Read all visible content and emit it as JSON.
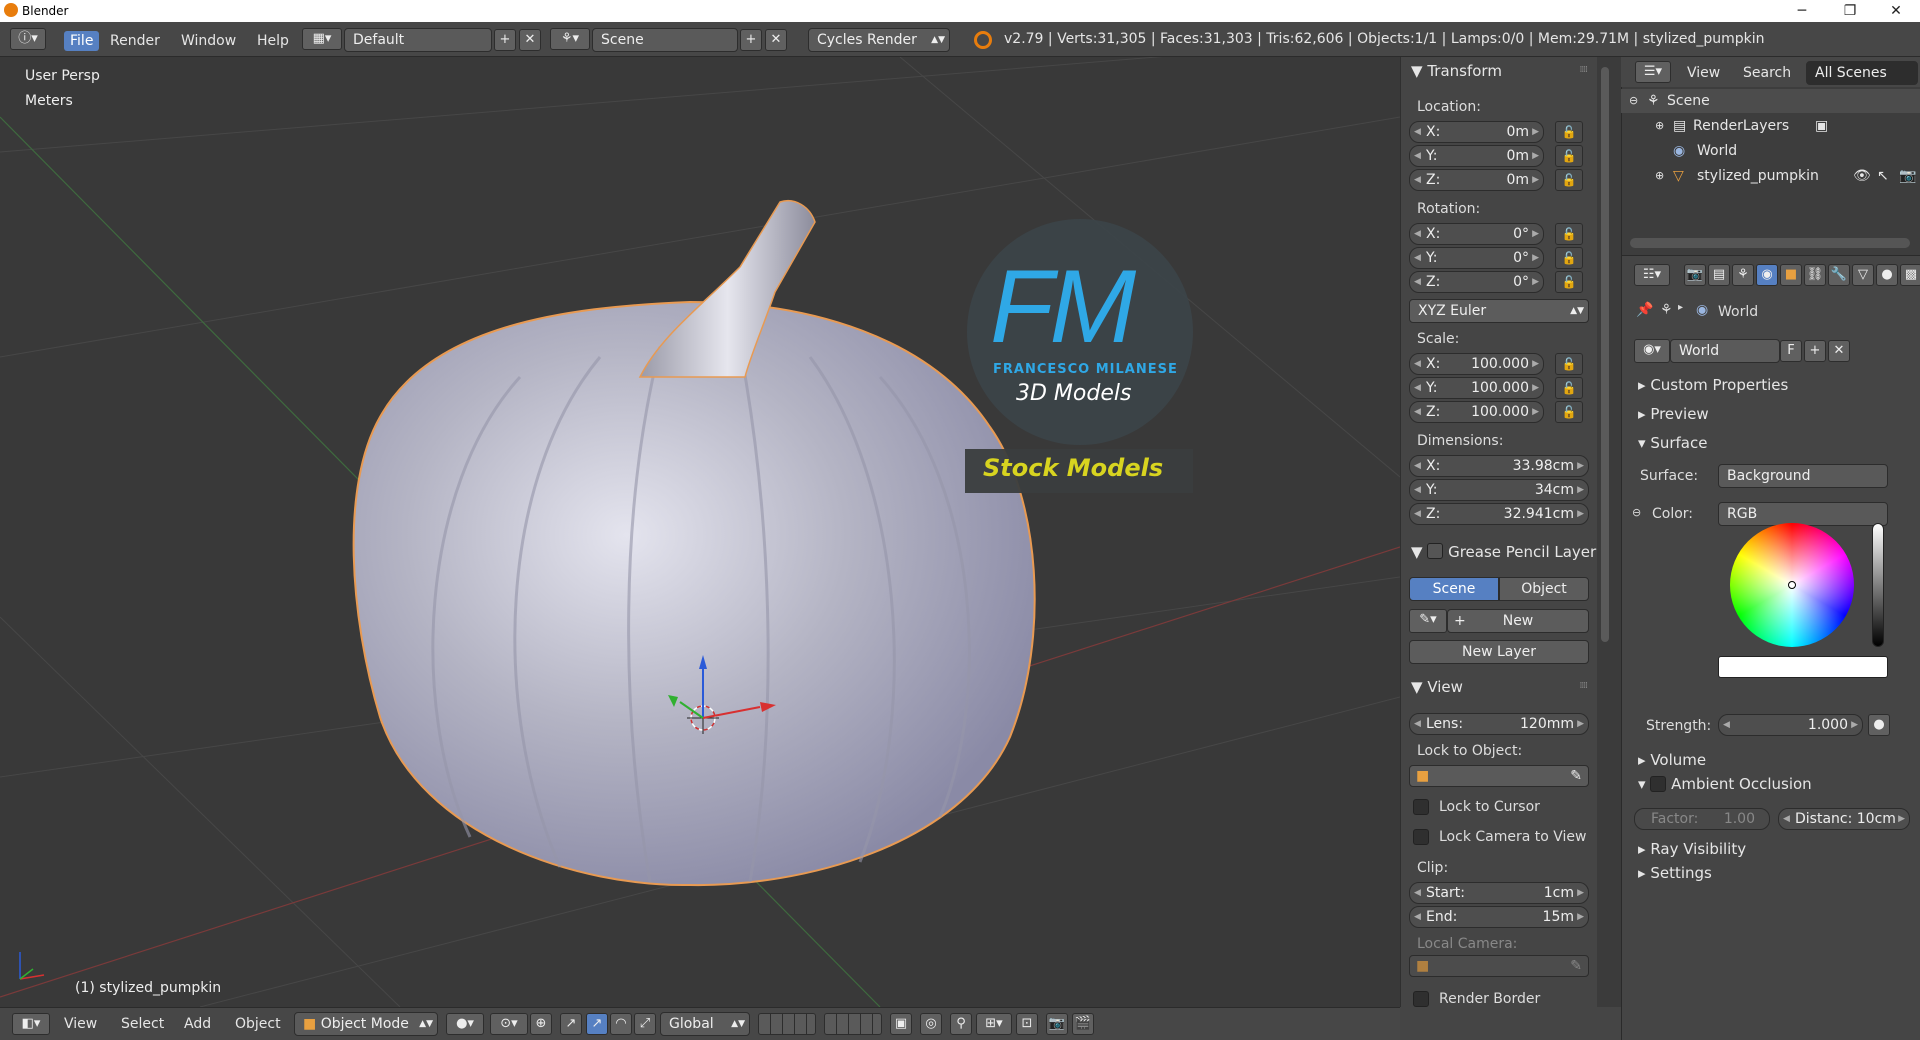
{
  "window": {
    "title": "Blender",
    "min": "─",
    "max": "❐",
    "close": "✕"
  },
  "menu": {
    "file": "File",
    "render": "Render",
    "window": "Window",
    "help": "Help"
  },
  "layout": {
    "name": "Default"
  },
  "scene": {
    "name": "Scene"
  },
  "engine": {
    "name": "Cycles Render"
  },
  "stats": "v2.79 | Verts:31,305 | Faces:31,303 | Tris:62,606 | Objects:1/1 | Lamps:0/0 | Mem:29.71M | stylized_pumpkin",
  "viewport": {
    "view_name": "User Persp",
    "units": "Meters",
    "object_label": "(1) stylized_pumpkin",
    "watermark": {
      "initials": "FM",
      "author": "FRANCESCO MILANESE",
      "tagline": "3D Models",
      "banner": "Stock Models"
    }
  },
  "transform": {
    "title": "Transform",
    "location_label": "Location:",
    "location": [
      {
        "k": "X:",
        "v": "0m"
      },
      {
        "k": "Y:",
        "v": "0m"
      },
      {
        "k": "Z:",
        "v": "0m"
      }
    ],
    "rotation_label": "Rotation:",
    "rotation": [
      {
        "k": "X:",
        "v": "0°"
      },
      {
        "k": "Y:",
        "v": "0°"
      },
      {
        "k": "Z:",
        "v": "0°"
      }
    ],
    "rotation_mode": "XYZ Euler",
    "scale_label": "Scale:",
    "scale": [
      {
        "k": "X:",
        "v": "100.000"
      },
      {
        "k": "Y:",
        "v": "100.000"
      },
      {
        "k": "Z:",
        "v": "100.000"
      }
    ],
    "dimensions_label": "Dimensions:",
    "dimensions": [
      {
        "k": "X:",
        "v": "33.98cm"
      },
      {
        "k": "Y:",
        "v": "34cm"
      },
      {
        "k": "Z:",
        "v": "32.941cm"
      }
    ]
  },
  "grease": {
    "title": "Grease Pencil Layer",
    "scene_tab": "Scene",
    "object_tab": "Object",
    "new": "New",
    "new_layer": "New Layer"
  },
  "view_panel": {
    "title": "View",
    "lens_label": "Lens:",
    "lens": "120mm",
    "lock_to_object": "Lock to Object:",
    "lock_cursor": "Lock to Cursor",
    "lock_camera": "Lock Camera to View",
    "clip": "Clip:",
    "clip_start_label": "Start:",
    "clip_start": "1cm",
    "clip_end_label": "End:",
    "clip_end": "15m",
    "local_camera": "Local Camera:",
    "render_border": "Render Border"
  },
  "outliner": {
    "view": "View",
    "search": "Search",
    "filter": "All Scenes",
    "items": [
      "Scene",
      "RenderLayers",
      "World",
      "stylized_pumpkin"
    ]
  },
  "properties": {
    "breadcrumb": "World",
    "world_name": "World",
    "fake_user": "F",
    "sections": {
      "custom": "Custom Properties",
      "preview": "Preview",
      "surface": "Surface",
      "volume": "Volume",
      "ao": "Ambient Occlusion",
      "ray": "Ray Visibility",
      "settings": "Settings"
    },
    "surface_label": "Surface:",
    "surface_value": "Background",
    "color_label": "Color:",
    "color_mode": "RGB",
    "strength_label": "Strength:",
    "strength": "1.000",
    "factor": "Factor:",
    "factor_value": "1.00",
    "distance": "Distanc: 10cm"
  },
  "bottom": {
    "view": "View",
    "select": "Select",
    "add": "Add",
    "object": "Object",
    "mode": "Object Mode",
    "orientation": "Global"
  },
  "colors": {
    "accent": "#5680c2",
    "selection": "#f0a050",
    "watermark_blue": "#2fa8e6",
    "watermark_yellow": "#d8d420"
  }
}
